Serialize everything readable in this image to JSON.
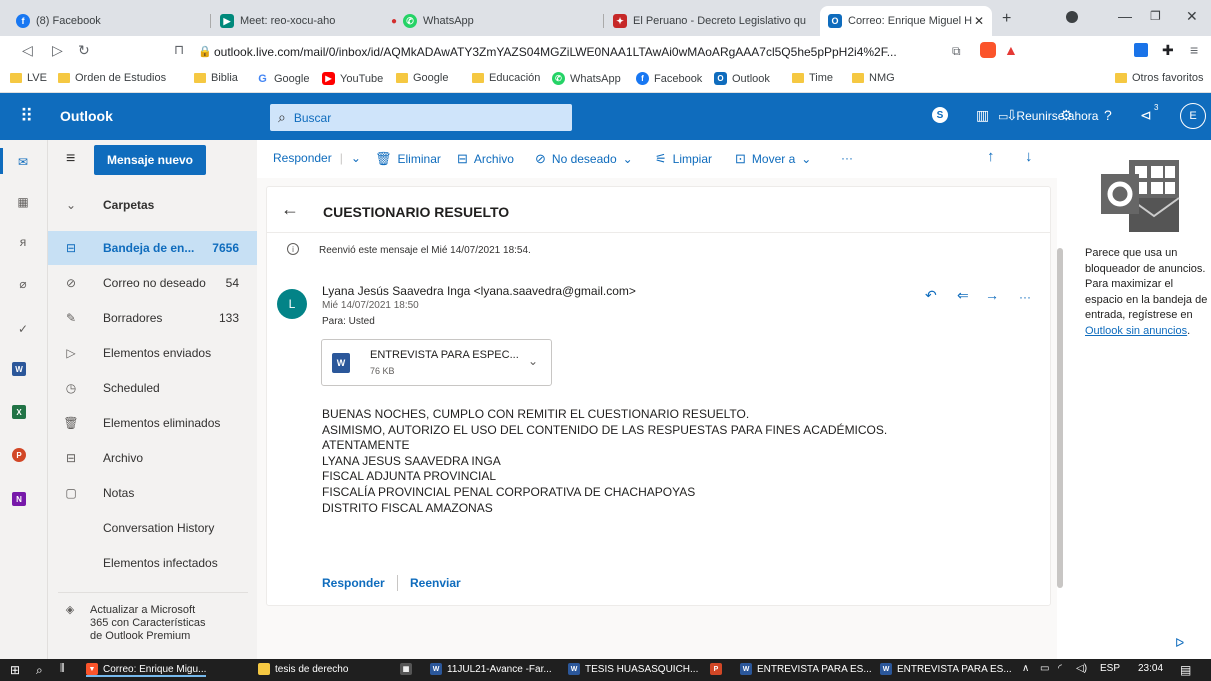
{
  "tabs": [
    {
      "title": "(8) Facebook",
      "color": "#1877f2",
      "glyph": "f"
    },
    {
      "title": "Meet: reo-xocu-aho",
      "color": "#00897b",
      "glyph": "▶"
    },
    {
      "title": "WhatsApp",
      "color": "#25d366",
      "glyph": "✆"
    },
    {
      "title": "El Peruano - Decreto Legislativo qu",
      "color": "#c62828",
      "glyph": "✦"
    },
    {
      "title": "Correo: Enrique Miguel Huasas",
      "color": "#0f6cbd",
      "glyph": "O"
    }
  ],
  "address": {
    "url": "outlook.live.com/mail/0/inbox/id/AQMkADAwATY3ZmYAZS04MGZiLWE0NAA1LTAwAi0wMAoARgAAA7cl5Q5he5pPpH2i4%2F..."
  },
  "bookmarks": [
    {
      "label": "LVE",
      "kind": "folder"
    },
    {
      "label": "Orden de Estudios",
      "kind": "folder"
    },
    {
      "label": "Biblia",
      "kind": "folder"
    },
    {
      "label": "Google",
      "kind": "google"
    },
    {
      "label": "YouTube",
      "kind": "youtube"
    },
    {
      "label": "Google",
      "kind": "folder"
    },
    {
      "label": "Educación",
      "kind": "folder"
    },
    {
      "label": "WhatsApp",
      "kind": "whatsapp"
    },
    {
      "label": "Facebook",
      "kind": "facebook"
    },
    {
      "label": "Outlook",
      "kind": "outlook"
    },
    {
      "label": "Time",
      "kind": "folder"
    },
    {
      "label": "NMG",
      "kind": "folder"
    }
  ],
  "other_bookmarks": "Otros favoritos",
  "header": {
    "brand": "Outlook",
    "search_placeholder": "Buscar",
    "meet_label": "Reunirse ahora",
    "avatar_initial": "E",
    "notif_count": "3"
  },
  "toolbar": {
    "new_message": "Mensaje nuevo",
    "reply": "Responder",
    "delete": "Eliminar",
    "archive": "Archivo",
    "junk": "No deseado",
    "sweep": "Limpiar",
    "move": "Mover a",
    "more": "···"
  },
  "folders": {
    "header": "Carpetas",
    "items": [
      {
        "label": "Bandeja de en...",
        "count": "7656",
        "icon": "inbox-icon"
      },
      {
        "label": "Correo no deseado",
        "count": "54",
        "icon": "junk-icon"
      },
      {
        "label": "Borradores",
        "count": "133",
        "icon": "drafts-icon"
      },
      {
        "label": "Elementos enviados",
        "count": "",
        "icon": "sent-icon"
      },
      {
        "label": "Scheduled",
        "count": "",
        "icon": "clock-icon"
      },
      {
        "label": "Elementos eliminados",
        "count": "",
        "icon": "trash-icon"
      },
      {
        "label": "Archivo",
        "count": "",
        "icon": "archive-icon"
      },
      {
        "label": "Notas",
        "count": "",
        "icon": "notes-icon"
      },
      {
        "label": "Conversation History",
        "count": "",
        "icon": ""
      },
      {
        "label": "Elementos infectados",
        "count": "",
        "icon": ""
      }
    ],
    "premium": [
      "Actualizar a Microsoft",
      "365 con Características",
      "de Outlook Premium"
    ]
  },
  "message": {
    "subject": "CUESTIONARIO RESUELTO",
    "info": "Reenvió este mensaje el Mié 14/07/2021 18:54.",
    "avatar": "L",
    "from": "Lyana Jesús Saavedra Inga <lyana.saavedra@gmail.com>",
    "date": "Mié 14/07/2021 18:50",
    "to": "Para: Usted",
    "attachment": {
      "name": "ENTREVISTA PARA ESPEC...",
      "size": "76 KB"
    },
    "body": [
      "BUENAS NOCHES, CUMPLO CON REMITIR EL CUESTIONARIO RESUELTO.",
      "ASIMISMO, AUTORIZO EL USO DEL CONTENIDO DE LAS RESPUESTAS PARA FINES ACADÉMICOS.",
      "ATENTAMENTE",
      "LYANA JESUS SAAVEDRA INGA",
      "FISCAL ADJUNTA PROVINCIAL",
      "FISCALÍA PROVINCIAL PENAL CORPORATIVA DE CHACHAPOYAS",
      "DISTRITO FISCAL AMAZONAS"
    ],
    "reply": "Responder",
    "forward": "Reenviar"
  },
  "ad": {
    "text": "Parece que usa un bloqueador de anuncios. Para maximizar el espacio en la bandeja de entrada, regístrese en ",
    "link": "Outlook sin anuncios",
    "end": "."
  },
  "taskbar": {
    "items": [
      {
        "label": "Correo: Enrique Migu...",
        "color": "#fb542b",
        "glyph": "▼"
      },
      {
        "label": "tesis de derecho",
        "color": "#f5c842",
        "glyph": ""
      },
      {
        "label": "",
        "color": "#555",
        "glyph": "▦"
      },
      {
        "label": "11JUL21-Avance -Far...",
        "color": "#2b579a",
        "glyph": "W"
      },
      {
        "label": "TESIS HUASASQUICH...",
        "color": "#2b579a",
        "glyph": "W"
      },
      {
        "label": "",
        "color": "#d24726",
        "glyph": "P"
      },
      {
        "label": "ENTREVISTA PARA ES...",
        "color": "#2b579a",
        "glyph": "W"
      },
      {
        "label": "ENTREVISTA PARA ES...",
        "color": "#2b579a",
        "glyph": "W"
      }
    ],
    "lang": "ESP",
    "time": "23:04"
  }
}
